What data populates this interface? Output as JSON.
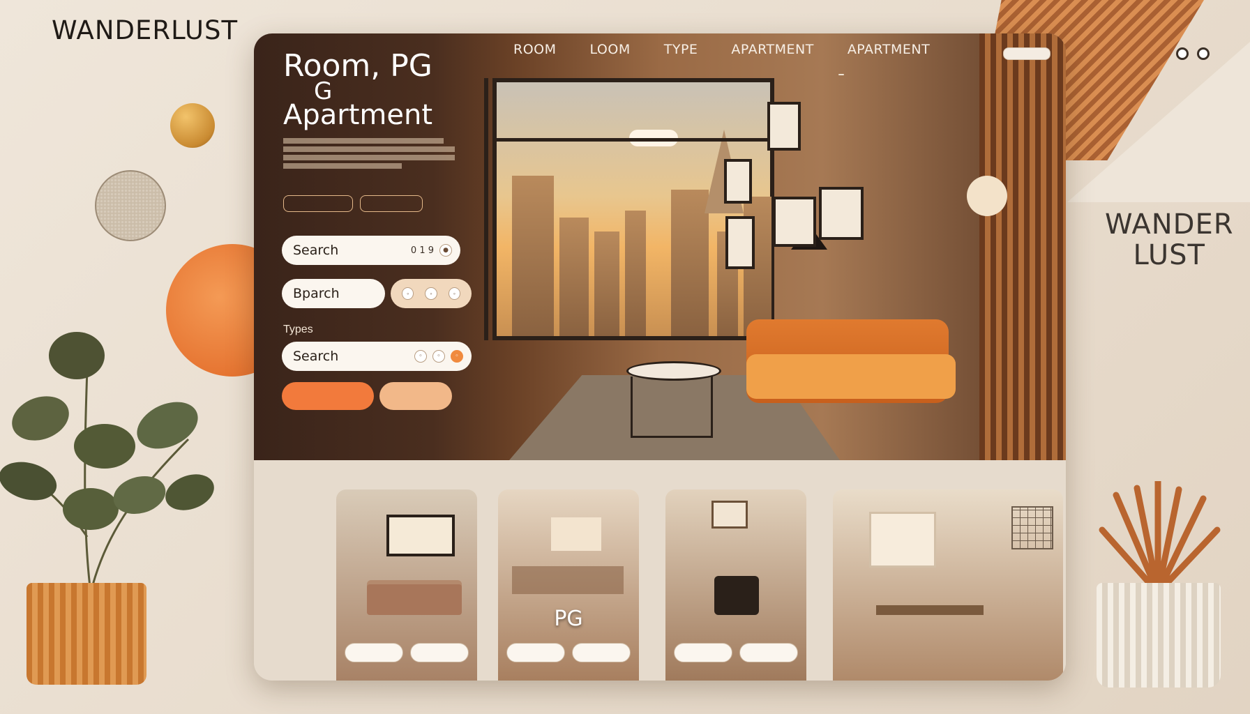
{
  "brand": {
    "name": "WANDERLUST",
    "side_line1": "WANDER",
    "side_line2": "LUST"
  },
  "nav": {
    "items": [
      "ROOM",
      "LOOM",
      "TYPE",
      "APARTMENT",
      "APARTMENT"
    ]
  },
  "hero": {
    "title_line1": "Room, PG",
    "title_line2": "G",
    "title_line3": "Apartment",
    "buttons": [
      "",
      ""
    ],
    "search1": {
      "placeholder": "Search",
      "meta": "0 1 9"
    },
    "search2": {
      "placeholder": "Bparch"
    },
    "types_label": "Types",
    "search3": {
      "placeholder": "Search"
    },
    "primary_cta": "",
    "secondary_cta": ""
  },
  "listings": {
    "cards": [
      {
        "label": "",
        "btn1": "",
        "btn2": ""
      },
      {
        "label": "PG",
        "btn1": "",
        "btn2": ""
      },
      {
        "label": "",
        "btn1": "",
        "btn2": ""
      },
      {
        "label": "",
        "btn1": "",
        "btn2": ""
      }
    ]
  },
  "colors": {
    "accent": "#f07a3a",
    "panel_dark": "#3a241a",
    "background": "#efe6da",
    "sofa": "#e07a2f"
  },
  "icons": [
    "dot-icon",
    "search-icon",
    "lamp-icon"
  ]
}
